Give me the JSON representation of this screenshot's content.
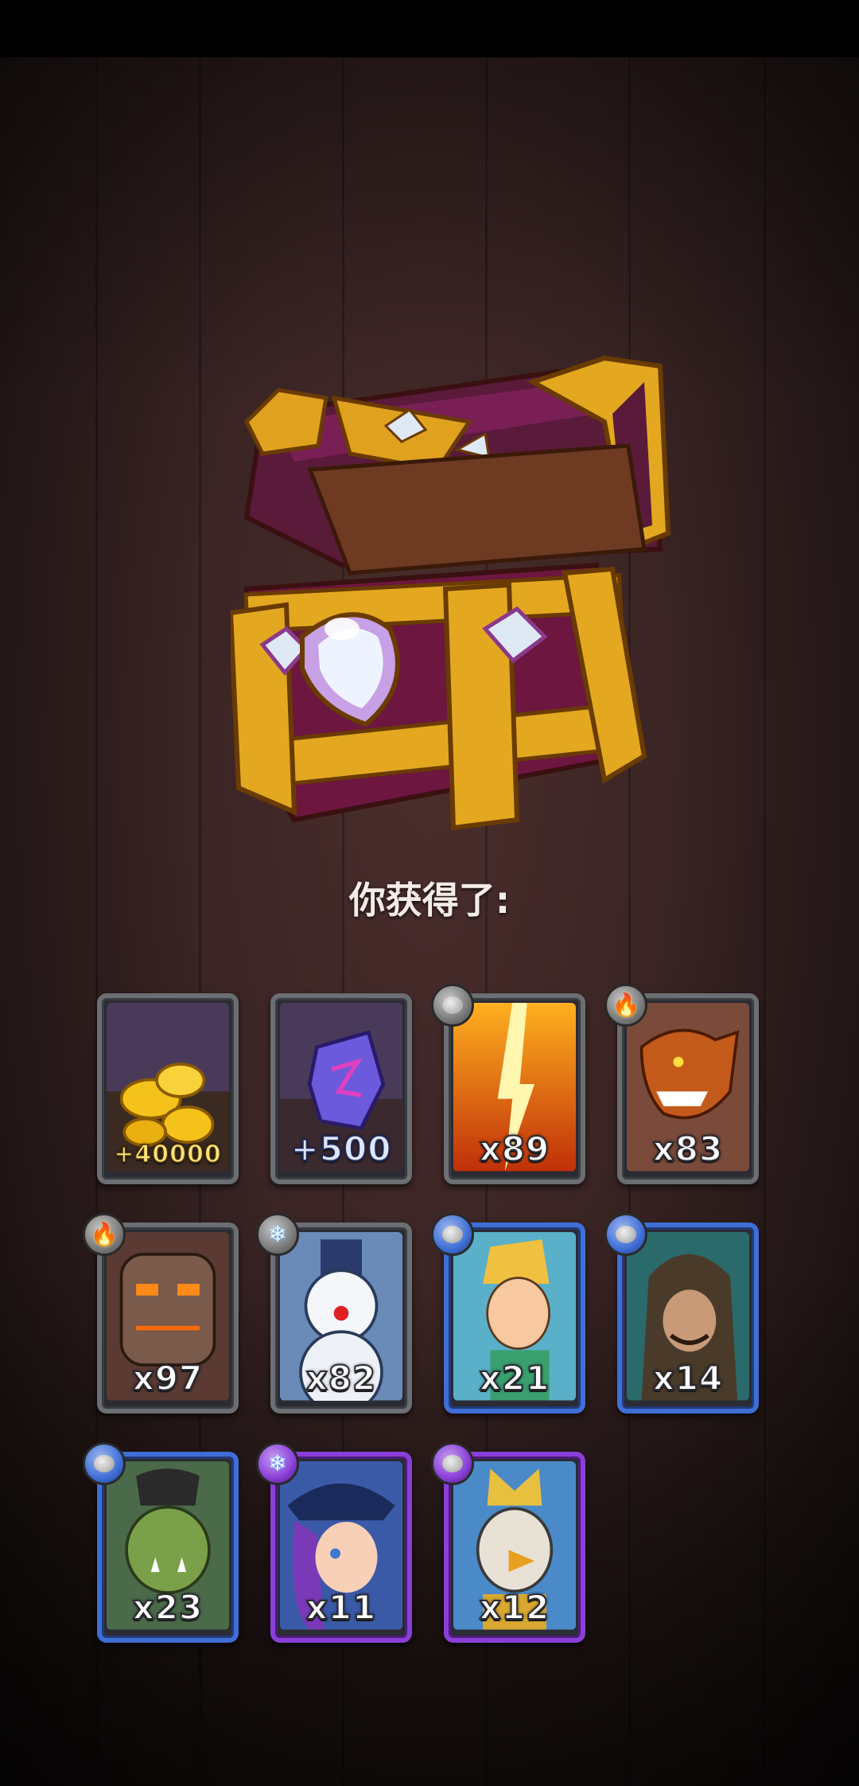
{
  "title": "你获得了:",
  "colors": {
    "common": "#6b6e72",
    "rare": "#3f6fd6",
    "epic": "#8a3fd8"
  },
  "rewards": [
    {
      "id": "gold",
      "label": "+40000",
      "rarity": "common",
      "icon": "gold-coins-icon"
    },
    {
      "id": "gem",
      "label": "+500",
      "rarity": "common",
      "icon": "purple-gem-icon"
    },
    {
      "id": "lightning",
      "label": "x89",
      "rarity": "common",
      "badge": "stone"
    },
    {
      "id": "dragon",
      "label": "x83",
      "rarity": "common",
      "badge": "fire"
    },
    {
      "id": "lava-golem",
      "label": "x97",
      "rarity": "common",
      "badge": "fire"
    },
    {
      "id": "snowman",
      "label": "x82",
      "rarity": "common",
      "badge": "ice"
    },
    {
      "id": "elf",
      "label": "x21",
      "rarity": "rare",
      "badge": "stone"
    },
    {
      "id": "hooded-rogue",
      "label": "x14",
      "rarity": "rare",
      "badge": "stone"
    },
    {
      "id": "orc",
      "label": "x23",
      "rarity": "rare",
      "badge": "stone"
    },
    {
      "id": "pirate-girl",
      "label": "x11",
      "rarity": "epic",
      "badge": "ice"
    },
    {
      "id": "griffin-knight",
      "label": "x12",
      "rarity": "epic",
      "badge": "stone"
    }
  ]
}
